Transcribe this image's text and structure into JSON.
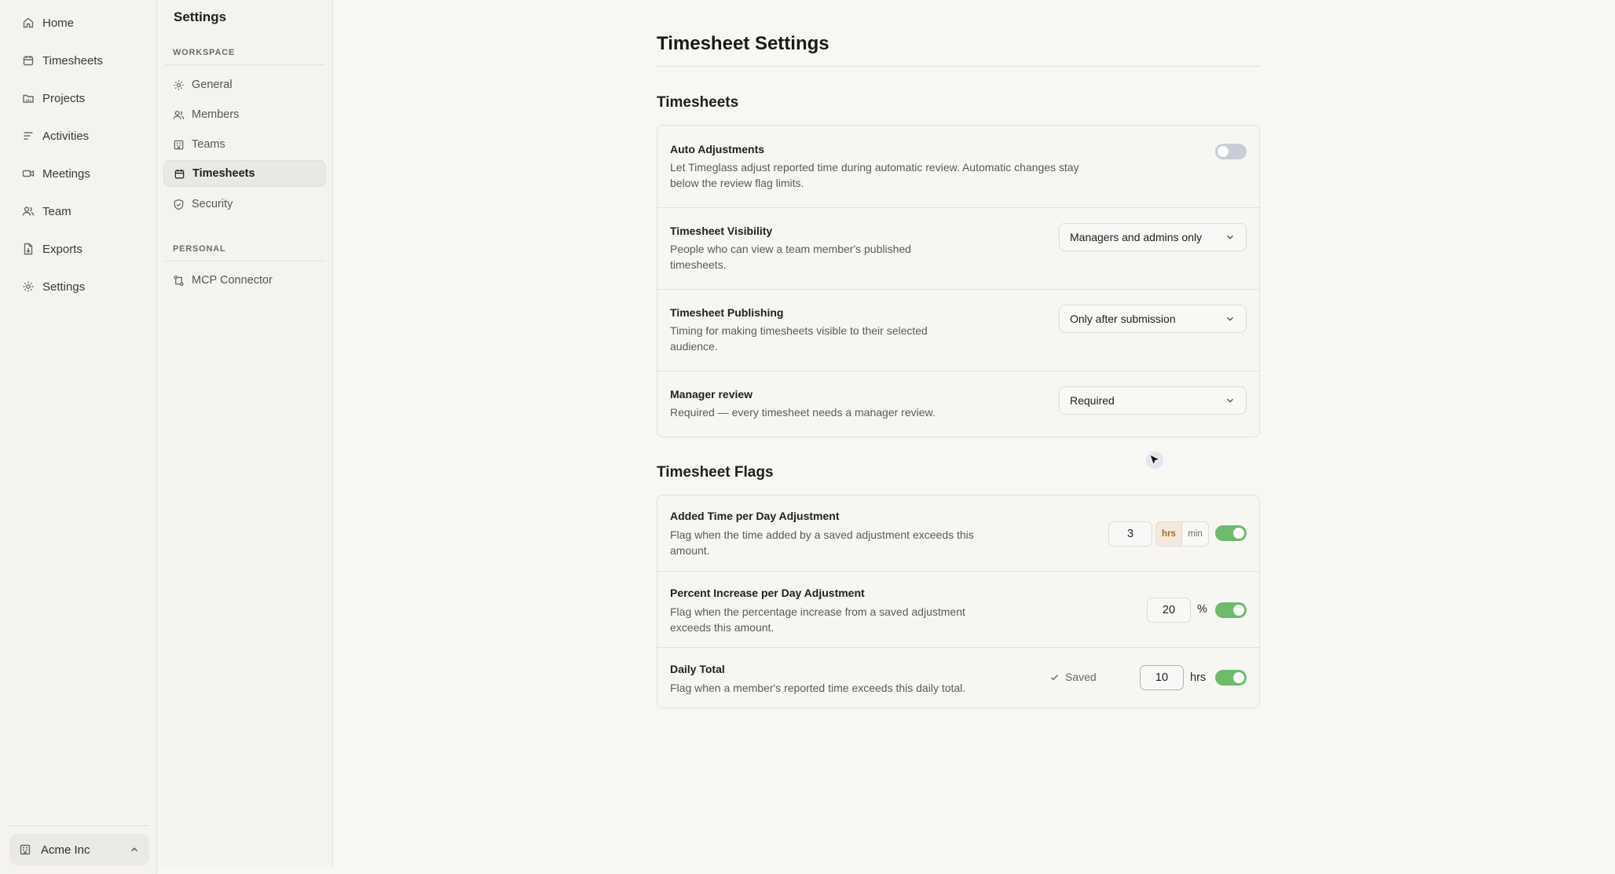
{
  "nav": {
    "items": [
      {
        "label": "Home",
        "icon": "home-icon"
      },
      {
        "label": "Timesheets",
        "icon": "calendar-icon"
      },
      {
        "label": "Projects",
        "icon": "folder-icon"
      },
      {
        "label": "Activities",
        "icon": "list-icon"
      },
      {
        "label": "Meetings",
        "icon": "video-icon"
      },
      {
        "label": "Team",
        "icon": "users-icon"
      },
      {
        "label": "Exports",
        "icon": "file-export-icon"
      },
      {
        "label": "Settings",
        "icon": "gear-icon"
      }
    ],
    "org_name": "Acme Inc"
  },
  "settings_nav": {
    "title": "Settings",
    "workspace_heading": "WORKSPACE",
    "workspace_items": [
      {
        "label": "General",
        "icon": "gear-icon"
      },
      {
        "label": "Members",
        "icon": "users-icon"
      },
      {
        "label": "Teams",
        "icon": "building-icon"
      },
      {
        "label": "Timesheets",
        "icon": "calendar-icon",
        "active": true
      },
      {
        "label": "Security",
        "icon": "shield-icon"
      }
    ],
    "personal_heading": "PERSONAL",
    "personal_items": [
      {
        "label": "MCP Connector",
        "icon": "connector-icon"
      }
    ]
  },
  "main": {
    "title": "Timesheet Settings",
    "timesheets_section": {
      "title": "Timesheets",
      "auto_adjustments": {
        "label": "Auto Adjustments",
        "desc_line1": "Let Timeglass adjust reported time during automatic review. Automatic changes stay",
        "desc_line2": "below the review flag limits.",
        "enabled": false
      },
      "visibility": {
        "label": "Timesheet Visibility",
        "desc_line1": "People who can view a team member's published",
        "desc_line2": "timesheets.",
        "value": "Managers and admins only"
      },
      "publishing": {
        "label": "Timesheet Publishing",
        "desc_line1": "Timing for making timesheets visible to their selected",
        "desc_line2": "audience.",
        "value": "Only after submission"
      },
      "manager_review": {
        "label": "Manager review",
        "desc": "Required — every timesheet needs a manager review.",
        "value": "Required"
      }
    },
    "flags_section": {
      "title": "Timesheet Flags",
      "added_time": {
        "label": "Added Time per Day Adjustment",
        "desc_line1": "Flag when the time added by a saved adjustment exceeds this",
        "desc_line2": "amount.",
        "value": "3",
        "unit_hrs": "hrs",
        "unit_min": "min",
        "selected_unit": "hrs",
        "enabled": true
      },
      "percent_increase": {
        "label": "Percent Increase per Day Adjustment",
        "desc_line1": "Flag when the percentage increase from a saved adjustment",
        "desc_line2": "exceeds this amount.",
        "value": "20",
        "unit": "%",
        "enabled": true
      },
      "daily_total": {
        "label": "Daily Total",
        "desc": "Flag when a member's reported time exceeds this daily total.",
        "saved_label": "Saved",
        "value": "10",
        "unit": "hrs",
        "enabled": true
      }
    }
  },
  "colors": {
    "background": "#f8f7f4",
    "sidebar": "#f4f3f0",
    "toggle_on": "#6dbb6b",
    "toggle_off": "#c9cdd6",
    "unit_selected": "#a86a2a"
  }
}
